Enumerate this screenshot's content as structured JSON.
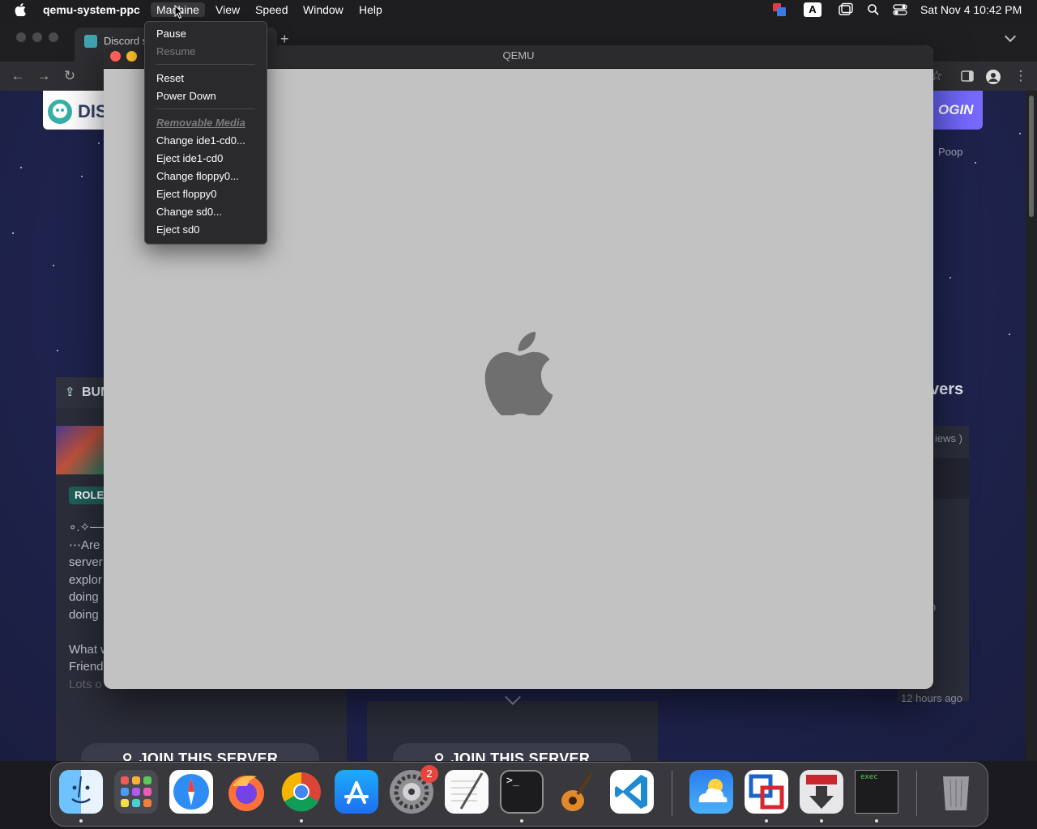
{
  "menubar": {
    "app_name": "qemu-system-ppc",
    "menus": [
      "Machine",
      "View",
      "Speed",
      "Window",
      "Help"
    ],
    "active_menu": "Machine",
    "keyboard_input": "A",
    "clock": "Sat Nov 4  10:42 PM"
  },
  "browser": {
    "tab_title": "Discord s",
    "new_tab": "+",
    "page": {
      "logo_text": "DIS",
      "login_label": "OGIN",
      "poop_label": "Poop",
      "bump_label": "BUM",
      "servers_label": "vers",
      "reviews_label": "iews )",
      "role_tag": "ROLE",
      "desc_lines": [
        "∘.✧───",
        "⋯Are y",
        "server",
        "explor",
        "doing",
        "doing",
        "",
        "What w",
        "Friend",
        "Lots o"
      ],
      "stray_char": "n",
      "timestamp": "12 hours ago",
      "join_label": "JOIN THIS SERVER"
    }
  },
  "qemu": {
    "title": "QEMU"
  },
  "machine_menu": {
    "items": [
      {
        "label": "Pause",
        "enabled": true
      },
      {
        "label": "Resume",
        "enabled": false
      },
      {
        "label": "Reset",
        "enabled": true
      },
      {
        "label": "Power Down",
        "enabled": true
      },
      {
        "label": "Removable Media",
        "enabled": false
      },
      {
        "label": "Change ide1-cd0...",
        "enabled": true
      },
      {
        "label": "Eject ide1-cd0",
        "enabled": true
      },
      {
        "label": "Change floppy0...",
        "enabled": true
      },
      {
        "label": "Eject floppy0",
        "enabled": true
      },
      {
        "label": "Change sd0...",
        "enabled": true
      },
      {
        "label": "Eject sd0",
        "enabled": true
      }
    ]
  },
  "dock": {
    "apps": [
      "finder-icon",
      "launchpad-icon",
      "safari-icon",
      "firefox-icon",
      "chrome-icon",
      "app-store-icon",
      "system-settings-icon",
      "textedit-icon",
      "terminal-icon",
      "garageband-icon",
      "vscode-icon",
      "weather-icon",
      "vmware-icon",
      "installer-icon",
      "exec-console-icon",
      "trash-icon"
    ],
    "settings_badge": "2",
    "terminal_prompt": ">_",
    "exec_label": "exec"
  },
  "colors": {
    "menu_bg": "#2a2a2c",
    "qemu_bg": "#c2c2c2",
    "apple_logo": "#6f6f6f",
    "traffic_red": "#fe5f57",
    "traffic_yellow": "#febc2e"
  }
}
